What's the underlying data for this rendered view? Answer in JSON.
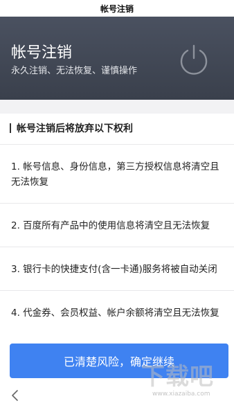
{
  "statusbar": {
    "title": "帐号注销"
  },
  "banner": {
    "title": "帐号注销",
    "subtitle": "永久注销、无法恢复、谨慎操作",
    "icon": "power-icon"
  },
  "section": {
    "title": "帐号注销后将放弃以下权利"
  },
  "items": [
    {
      "text": "1. 帐号信息、身份信息，第三方授权信息将清空且无法恢复"
    },
    {
      "text": "2. 百度所有产品中的使用信息将清空且无法恢复"
    },
    {
      "text": "3. 银行卡的快捷支付(含一卡通)服务将被自动关闭"
    },
    {
      "text": "4. 代金券、会员权益、帐户余额将清空且无法恢复"
    }
  ],
  "actions": {
    "confirm_label": "已清楚风险，确定继续"
  },
  "watermark": {
    "brand": "下载吧",
    "url": "www.xiazaiba.com"
  },
  "colors": {
    "banner": "#3f4551",
    "accent": "#3f82f1"
  }
}
